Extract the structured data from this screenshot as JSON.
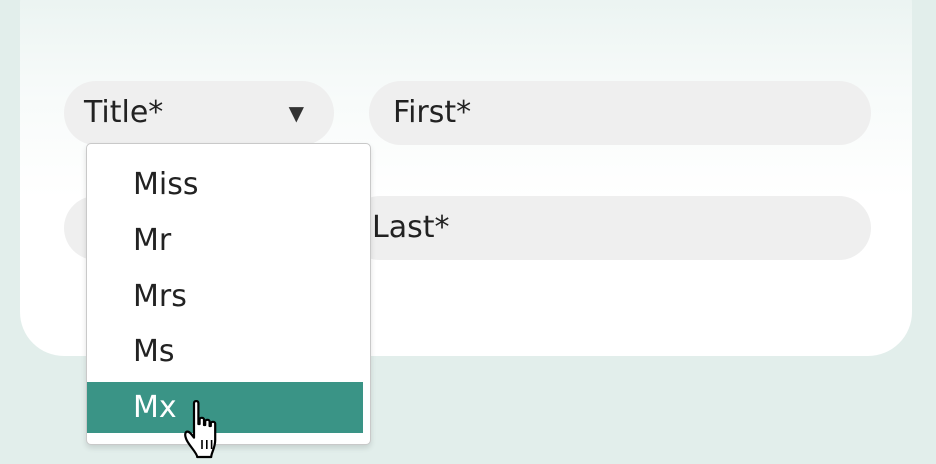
{
  "form": {
    "title_placeholder": "Title*",
    "first_placeholder": "First*",
    "last_placeholder": "Last*",
    "caret_glyph": "▼",
    "caret_icon": "triangle-down-icon"
  },
  "dropdown": {
    "options": [
      {
        "label": "Miss"
      },
      {
        "label": "Mr"
      },
      {
        "label": "Mrs"
      },
      {
        "label": "Ms"
      },
      {
        "label": "Mx"
      }
    ],
    "highlighted_index": 4
  },
  "colors": {
    "background": "#e2eeeb",
    "field_background": "#efefef",
    "highlight": "#3a9486",
    "highlight_text": "#ffffff"
  },
  "cursor": {
    "icon": "hand-pointer-icon"
  }
}
